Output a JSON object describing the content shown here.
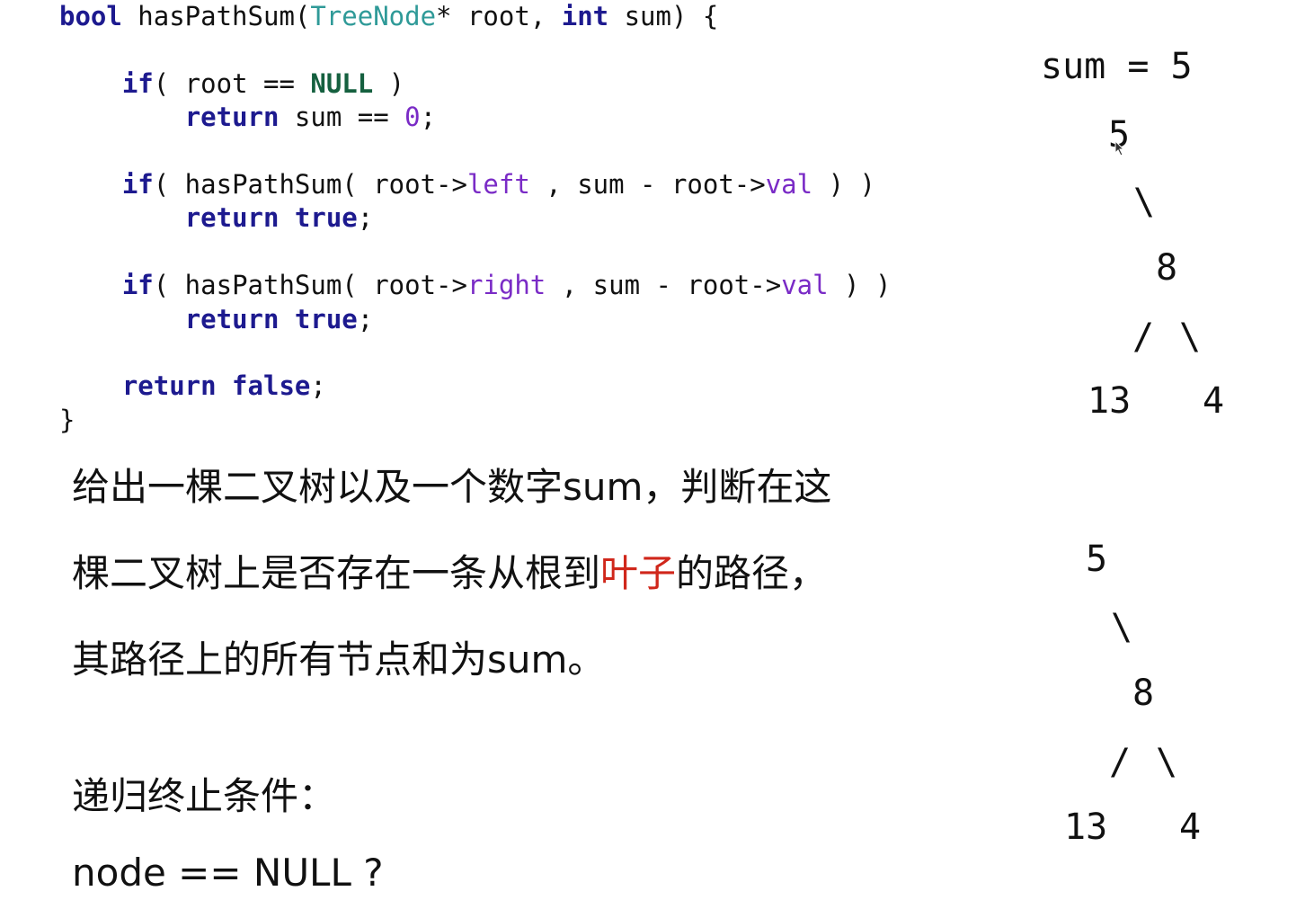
{
  "code": {
    "l1": {
      "kw1": "bool",
      "t1": " hasPathSum(",
      "ty": "TreeNode",
      "t2": "* root, ",
      "kw2": "int",
      "t3": " sum) {"
    },
    "l2": {
      "pre": "    ",
      "kw": "if",
      "t1": "( root == ",
      "null": "NULL",
      "t2": " )"
    },
    "l3": {
      "pre": "        ",
      "kw": "return",
      "t1": " sum == ",
      "zero": "0",
      "t2": ";"
    },
    "l5": {
      "pre": "    ",
      "kw": "if",
      "t1": "( hasPathSum( root->",
      "m1": "left",
      "t2": " , sum - root->",
      "m2": "val",
      "t3": " ) )"
    },
    "l6": {
      "pre": "        ",
      "kw": "return true",
      "t1": ";"
    },
    "l8": {
      "pre": "    ",
      "kw": "if",
      "t1": "( hasPathSum( root->",
      "m1": "right",
      "t2": " , sum - root->",
      "m2": "val",
      "t3": " ) )"
    },
    "l9": {
      "pre": "        ",
      "kw": "return true",
      "t1": ";"
    },
    "l11": {
      "pre": "    ",
      "kw": "return false",
      "t1": ";"
    },
    "l12": "}"
  },
  "description": {
    "line1": "给出一棵二叉树以及一个数字sum，判断在这",
    "line2_before": "棵二叉树上是否存在一条从根到",
    "line2_highlight": "叶子",
    "line2_after": "的路径，",
    "line3": "其路径上的所有节点和为sum。"
  },
  "termination": {
    "title": "递归终止条件：",
    "condition": "node == NULL ?"
  },
  "tree1": {
    "label": "sum = 5",
    "root": "5",
    "edge_root": "\\",
    "mid": "8",
    "edge_left": "/",
    "edge_right": "\\",
    "leaf_left": "13",
    "leaf_right": "4"
  },
  "tree2": {
    "root": "5",
    "edge_root": "\\",
    "mid": "8",
    "edge_left": "/",
    "edge_right": "\\",
    "leaf_left": "13",
    "leaf_right": "4"
  },
  "colors": {
    "keyword": "#1d1a8f",
    "type": "#2f9a98",
    "member": "#7a2bc6",
    "null_const": "#15603f",
    "highlight": "#d0271b"
  }
}
